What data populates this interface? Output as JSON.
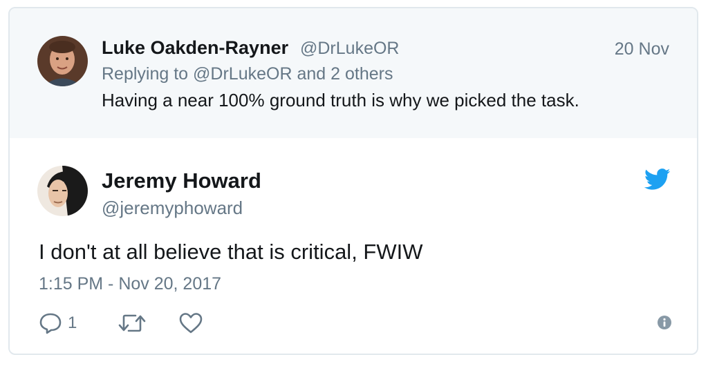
{
  "parent_tweet": {
    "author_name": "Luke Oakden-Rayner",
    "author_handle": "@DrLukeOR",
    "date": "20 Nov",
    "replying_prefix": "Replying to",
    "replying_handle": "@DrLukeOR",
    "replying_suffix": "and 2 others",
    "text": "Having a near 100% ground truth is why we picked the task."
  },
  "main_tweet": {
    "author_name": "Jeremy Howard",
    "author_handle": "@jeremyphoward",
    "text": "I don't at all believe that is critical, FWIW",
    "timestamp": "1:15 PM - Nov 20, 2017",
    "reply_count": "1"
  },
  "icons": {
    "brand": "twitter-bird-icon",
    "reply": "reply-icon",
    "retweet": "retweet-icon",
    "like": "heart-icon",
    "info": "info-icon"
  },
  "colors": {
    "twitter_blue": "#1da1f2",
    "muted_text": "#657786",
    "parent_background": "#f5f8fa"
  }
}
